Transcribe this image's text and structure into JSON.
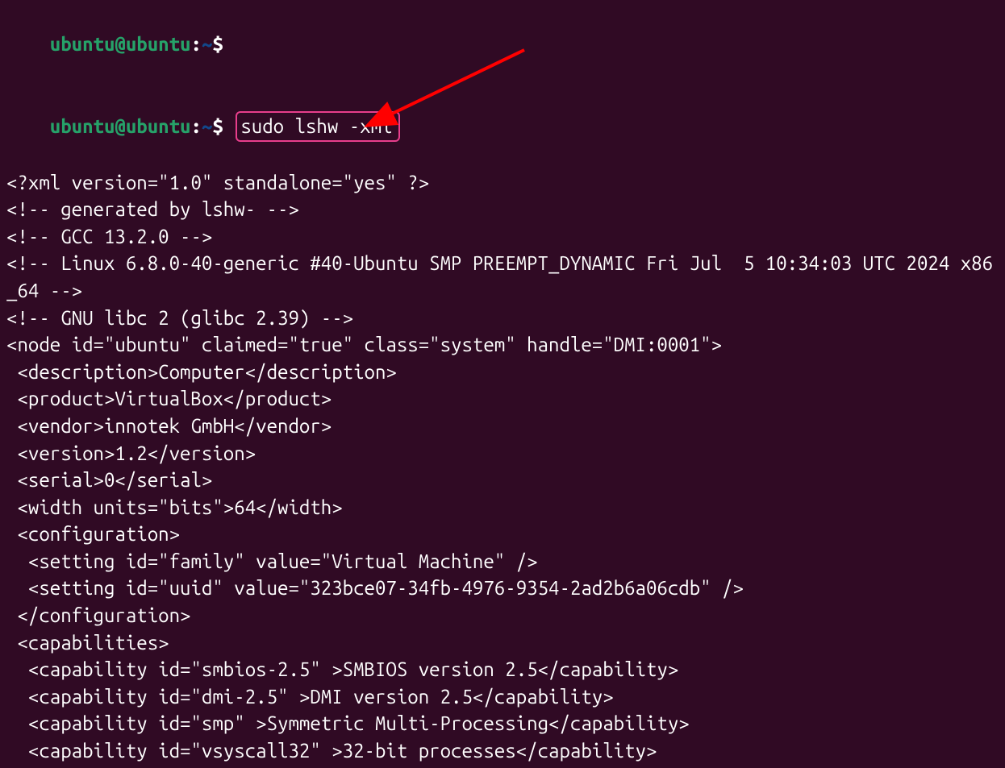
{
  "prompt": {
    "user": "ubuntu",
    "at": "@",
    "host": "ubuntu",
    "colon": ":",
    "path": "~",
    "dollar": "$"
  },
  "command": "sudo lshw -xml",
  "output_lines": [
    "<?xml version=\"1.0\" standalone=\"yes\" ?>",
    "<!-- generated by lshw- -->",
    "<!-- GCC 13.2.0 -->",
    "<!-- Linux 6.8.0-40-generic #40-Ubuntu SMP PREEMPT_DYNAMIC Fri Jul  5 10:34:03 UTC 2024 x86_64 -->",
    "<!-- GNU libc 2 (glibc 2.39) -->",
    "<node id=\"ubuntu\" claimed=\"true\" class=\"system\" handle=\"DMI:0001\">",
    " <description>Computer</description>",
    " <product>VirtualBox</product>",
    " <vendor>innotek GmbH</vendor>",
    " <version>1.2</version>",
    " <serial>0</serial>",
    " <width units=\"bits\">64</width>",
    " <configuration>",
    "  <setting id=\"family\" value=\"Virtual Machine\" />",
    "  <setting id=\"uuid\" value=\"323bce07-34fb-4976-9354-2ad2b6a06cdb\" />",
    " </configuration>",
    " <capabilities>",
    "  <capability id=\"smbios-2.5\" >SMBIOS version 2.5</capability>",
    "  <capability id=\"dmi-2.5\" >DMI version 2.5</capability>",
    "  <capability id=\"smp\" >Symmetric Multi-Processing</capability>",
    "  <capability id=\"vsyscall32\" >32-bit processes</capability>"
  ],
  "colors": {
    "background": "#300a24",
    "text": "#ffffff",
    "prompt_green": "#26a269",
    "prompt_blue": "#12488b",
    "highlight_border": "#e83e8c",
    "arrow": "#ff0000"
  }
}
